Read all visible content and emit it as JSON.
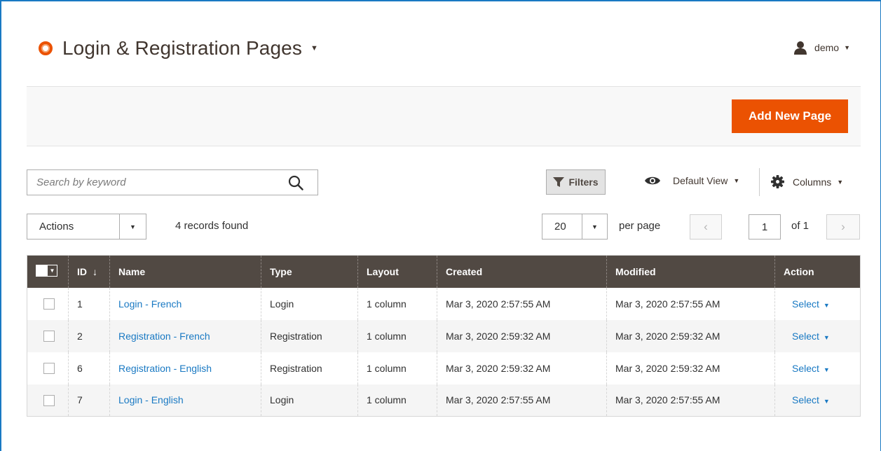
{
  "header": {
    "title": "Login & Registration Pages",
    "user": "demo"
  },
  "action_bar": {
    "add_button": "Add New Page"
  },
  "toolbar": {
    "search_placeholder": "Search by keyword",
    "filters_label": "Filters",
    "view_label": "Default View",
    "columns_label": "Columns",
    "actions_label": "Actions",
    "records_found": "4 records found",
    "per_page_value": "20",
    "per_page_label": "per page",
    "page_current": "1",
    "page_total": "of 1"
  },
  "table": {
    "columns": [
      "ID",
      "Name",
      "Type",
      "Layout",
      "Created",
      "Modified",
      "Action"
    ],
    "sort_indicator": "↓",
    "rows": [
      {
        "id": "1",
        "name": "Login - French",
        "type": "Login",
        "layout": "1 column",
        "created": "Mar 3, 2020 2:57:55 AM",
        "modified": "Mar 3, 2020 2:57:55 AM",
        "action": "Select"
      },
      {
        "id": "2",
        "name": "Registration - French",
        "type": "Registration",
        "layout": "1 column",
        "created": "Mar 3, 2020 2:59:32 AM",
        "modified": "Mar 3, 2020 2:59:32 AM",
        "action": "Select"
      },
      {
        "id": "6",
        "name": "Registration - English",
        "type": "Registration",
        "layout": "1 column",
        "created": "Mar 3, 2020 2:59:32 AM",
        "modified": "Mar 3, 2020 2:59:32 AM",
        "action": "Select"
      },
      {
        "id": "7",
        "name": "Login - English",
        "type": "Login",
        "layout": "1 column",
        "created": "Mar 3, 2020 2:57:55 AM",
        "modified": "Mar 3, 2020 2:57:55 AM",
        "action": "Select"
      }
    ]
  },
  "colors": {
    "accent": "#eb5202",
    "header_bg": "#514943",
    "link": "#1979c3"
  },
  "icons": [
    "logo-icon",
    "title-caret-icon",
    "user-icon",
    "search-icon",
    "filter-icon",
    "eye-icon",
    "gear-icon",
    "chevron-down-icon",
    "chevron-left-icon",
    "chevron-right-icon"
  ]
}
